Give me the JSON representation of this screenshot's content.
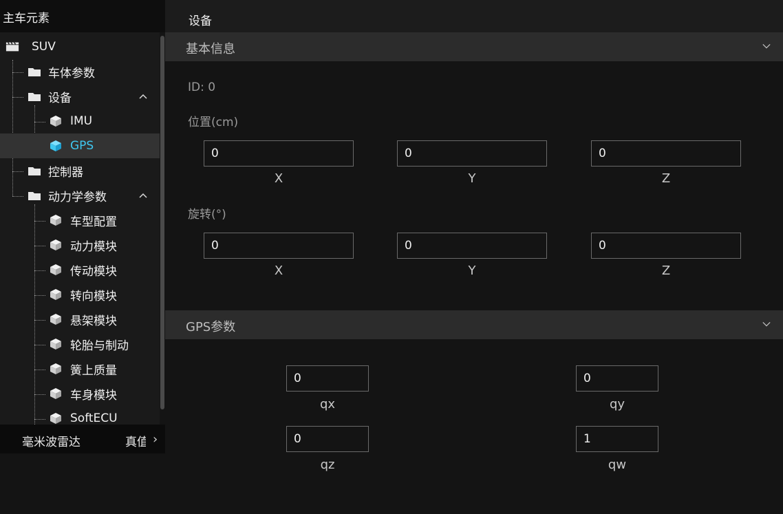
{
  "left_panel": {
    "header": "主车元素",
    "tree": [
      {
        "label": "SUV",
        "icon": "vehicle-icon",
        "level": 0
      },
      {
        "label": "车体参数",
        "icon": "folder-icon",
        "level": 1
      },
      {
        "label": "设备",
        "icon": "folder-icon",
        "level": 1,
        "expanded": true,
        "chevron": "^"
      },
      {
        "label": "IMU",
        "icon": "cube-icon",
        "level": 2
      },
      {
        "label": "GPS",
        "icon": "cube-icon",
        "level": 2,
        "selected": true
      },
      {
        "label": "控制器",
        "icon": "folder-icon",
        "level": 1
      },
      {
        "label": "动力学参数",
        "icon": "folder-icon",
        "level": 1,
        "expanded": true,
        "chevron": "^"
      },
      {
        "label": "车型配置",
        "icon": "cube-icon",
        "level": 2
      },
      {
        "label": "动力模块",
        "icon": "cube-icon",
        "level": 2
      },
      {
        "label": "传动模块",
        "icon": "cube-icon",
        "level": 2
      },
      {
        "label": "转向模块",
        "icon": "cube-icon",
        "level": 2
      },
      {
        "label": "悬架模块",
        "icon": "cube-icon",
        "level": 2
      },
      {
        "label": "轮胎与制动",
        "icon": "cube-icon",
        "level": 2
      },
      {
        "label": "簧上质量",
        "icon": "cube-icon",
        "level": 2
      },
      {
        "label": "车身模块",
        "icon": "cube-icon",
        "level": 2
      },
      {
        "label": "SoftECU",
        "icon": "cube-icon",
        "level": 2
      }
    ],
    "bottom_tabs": [
      "毫米波雷达",
      "真值"
    ],
    "bottom_arrow": "›"
  },
  "right_panel": {
    "title": "设备",
    "basic_info": {
      "section_title": "基本信息",
      "id_text": "ID: 0",
      "position_label": "位置(cm)",
      "position": {
        "x": "0",
        "y": "0",
        "z": "0"
      },
      "rotation_label": "旋转(°)",
      "rotation": {
        "x": "0",
        "y": "0",
        "z": "0"
      },
      "axis_labels": {
        "x": "X",
        "y": "Y",
        "z": "Z"
      }
    },
    "gps_params": {
      "section_title": "GPS参数",
      "qx": "0",
      "qy": "0",
      "qz": "0",
      "qw": "1",
      "labels": {
        "qx": "qx",
        "qy": "qy",
        "qz": "qz",
        "qw": "qw"
      }
    }
  },
  "colors": {
    "accent": "#3fc7f0",
    "selected_row": "#333333",
    "section_bar": "#2c2c2c"
  }
}
